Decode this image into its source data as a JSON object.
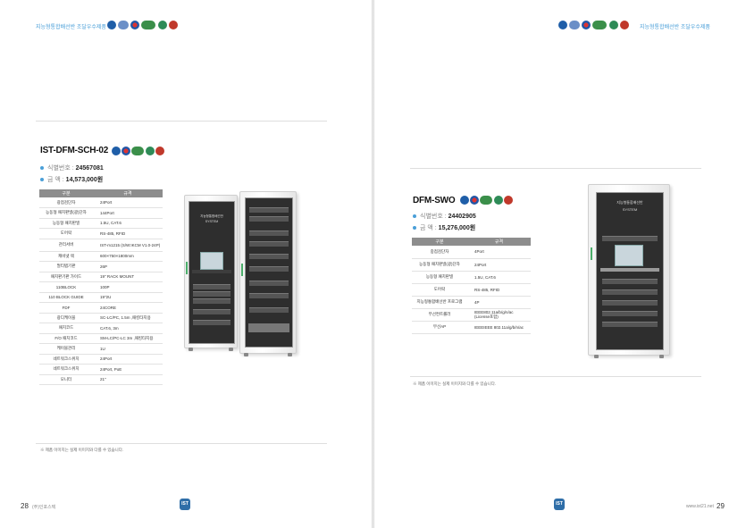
{
  "header": {
    "left_text": "지능형통합배선반 조달우수제품",
    "right_text": "지능형통합배선반 조달우수제품",
    "logos": [
      "certification-logo-1",
      "certification-logo-2",
      "korea-emblem",
      "procurement-logo",
      "green-logo",
      "pps-logo"
    ]
  },
  "left": {
    "product_name": "IST-DFM-SCH-02",
    "id_label": "식별번호 :",
    "id_value": "24567081",
    "price_label": "금      액 :",
    "price_value": "14,573,000원",
    "table_headers": [
      "구분",
      "규격"
    ],
    "rows": [
      {
        "k": "광점검단자",
        "v": "24Port"
      },
      {
        "k": "능동형 패치판넬(광)단자",
        "v": "144Port"
      },
      {
        "k": "능동형 패치판넬",
        "v": "1.5U, CAT.6"
      },
      {
        "k": "도어락",
        "v": "RS-485, RFID"
      },
      {
        "k": "관리서버",
        "v": "IST-m1215 (S/W:IKCM V1.0-24P)"
      },
      {
        "k": "캐비넷 랙",
        "v": "600×750×1800mm"
      },
      {
        "k": "멀티탭기판",
        "v": "26P"
      },
      {
        "k": "패치판기판 가이드",
        "v": "19\" RACK MOUNT"
      },
      {
        "k": "110BLOCK",
        "v": "100P"
      },
      {
        "k": "110 BLOCK GUIDE",
        "v": "19\"2U"
      },
      {
        "k": "FDF",
        "v": "24CORE"
      },
      {
        "k": "광디케이블",
        "v": "SC-LC/PC, 1.5m ,패킹타지용"
      },
      {
        "k": "패치코드",
        "v": "CAT.6, 3m"
      },
      {
        "k": "F/O 패치코드",
        "v": "SM-LC/PC-LC 3m ,패킹타지용"
      },
      {
        "k": "케이블관리",
        "v": "1U"
      },
      {
        "k": "네트워크스위치",
        "v": "24Port"
      },
      {
        "k": "네트워크스위치",
        "v": "24Port, PoE"
      },
      {
        "k": "모니터",
        "v": "21\""
      }
    ],
    "note": "※ 제품 이미지는 실제 이미지와 다를 수 있습니다.",
    "page_number": "28",
    "company": "(주)인포스텍",
    "cabinet_label_1": "지능형통합배선반",
    "cabinet_label_2": "SYSTEM"
  },
  "right": {
    "product_name": "DFM-SWO",
    "id_label": "식별번호 :",
    "id_value": "24402905",
    "price_label": "금      액 :",
    "price_value": "15,276,000원",
    "table_headers": [
      "구분",
      "규격"
    ],
    "rows": [
      {
        "k": "중점검단자",
        "v": "4Port"
      },
      {
        "k": "능동형 패치판넬(광)단자",
        "v": "24Port"
      },
      {
        "k": "능동형 패치판넬",
        "v": "1.5U, CAT.6"
      },
      {
        "k": "도어락",
        "v": "RS-485, RFID"
      },
      {
        "k": "지능형통합배선반 프로그램",
        "v": "4P"
      },
      {
        "k": "무선컨트롤러",
        "v": "IEEE802.11a/b/g/n/ac (License포함)"
      },
      {
        "k": "무선AP",
        "v": "IEEEIEEE 802.11a/g/b/n/ac"
      }
    ],
    "note": "※ 제품 이미지는 실제 이미지와 다를 수 있습니다.",
    "page_number": "29",
    "site": "www.ist21.net",
    "cabinet_label_1": "지능형통합배선반",
    "cabinet_label_2": "SYSTEM"
  },
  "badge_text": "IST"
}
